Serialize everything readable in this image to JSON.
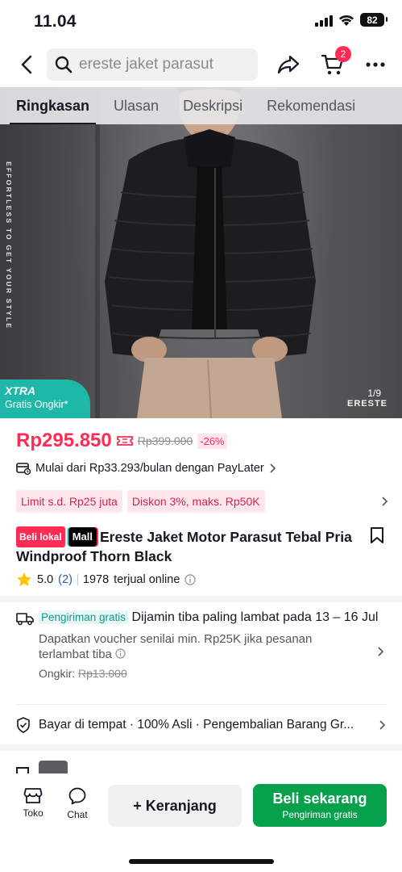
{
  "status_bar": {
    "time": "11.04",
    "battery": "82"
  },
  "search": {
    "value": "ereste jaket parasut"
  },
  "cart": {
    "badge": "2"
  },
  "tabs": [
    {
      "label": "Ringkasan",
      "active": true
    },
    {
      "label": "Ulasan",
      "active": false
    },
    {
      "label": "Deskripsi",
      "active": false
    },
    {
      "label": "Rekomendasi",
      "active": false
    }
  ],
  "hero": {
    "vertical_text": "EFFORTLESS TO GET YOUR STYLE",
    "xtra_title": "XTRA",
    "xtra_sub": "Gratis Ongkir*",
    "counter": "1/9",
    "brand": "ERESTE"
  },
  "price": {
    "current": "Rp295.850",
    "original": "Rp399.000",
    "discount": "-26%"
  },
  "paylater": {
    "text": "Mulai dari Rp33.293/bulan dengan PayLater"
  },
  "promos": [
    "Limit s.d. Rp25 juta",
    "Diskon 3%, maks. Rp50K"
  ],
  "product": {
    "badge_local": "Beli lokal",
    "badge_mall": "Mall",
    "title": "Ereste Jaket Motor Parasut Tebal Pria Windproof Thorn Black",
    "rating": "5.0",
    "rating_count": "(2)",
    "sold": "1978",
    "sold_label": "terjual online"
  },
  "shipping": {
    "badge": "Pengiriman gratis",
    "text": "Dijamin tiba paling lambat pada 13 – 16 Jul",
    "voucher": "Dapatkan voucher senilai min. Rp25K jika pesanan terlambat tiba",
    "fee_label": "Ongkir:",
    "fee_value": "Rp13.000"
  },
  "service": {
    "text": "Bayar di tempat · 100% Asli · Pengembalian Barang Gr..."
  },
  "bottom": {
    "store_label": "Toko",
    "chat_label": "Chat",
    "cart_button": "+ Keranjang",
    "buy_button": "Beli sekarang",
    "buy_sub": "Pengiriman gratis"
  },
  "colors": {
    "accent_red": "#fe2c55",
    "buy_green": "#07a14c",
    "xtra_teal": "#1fb8a8"
  }
}
